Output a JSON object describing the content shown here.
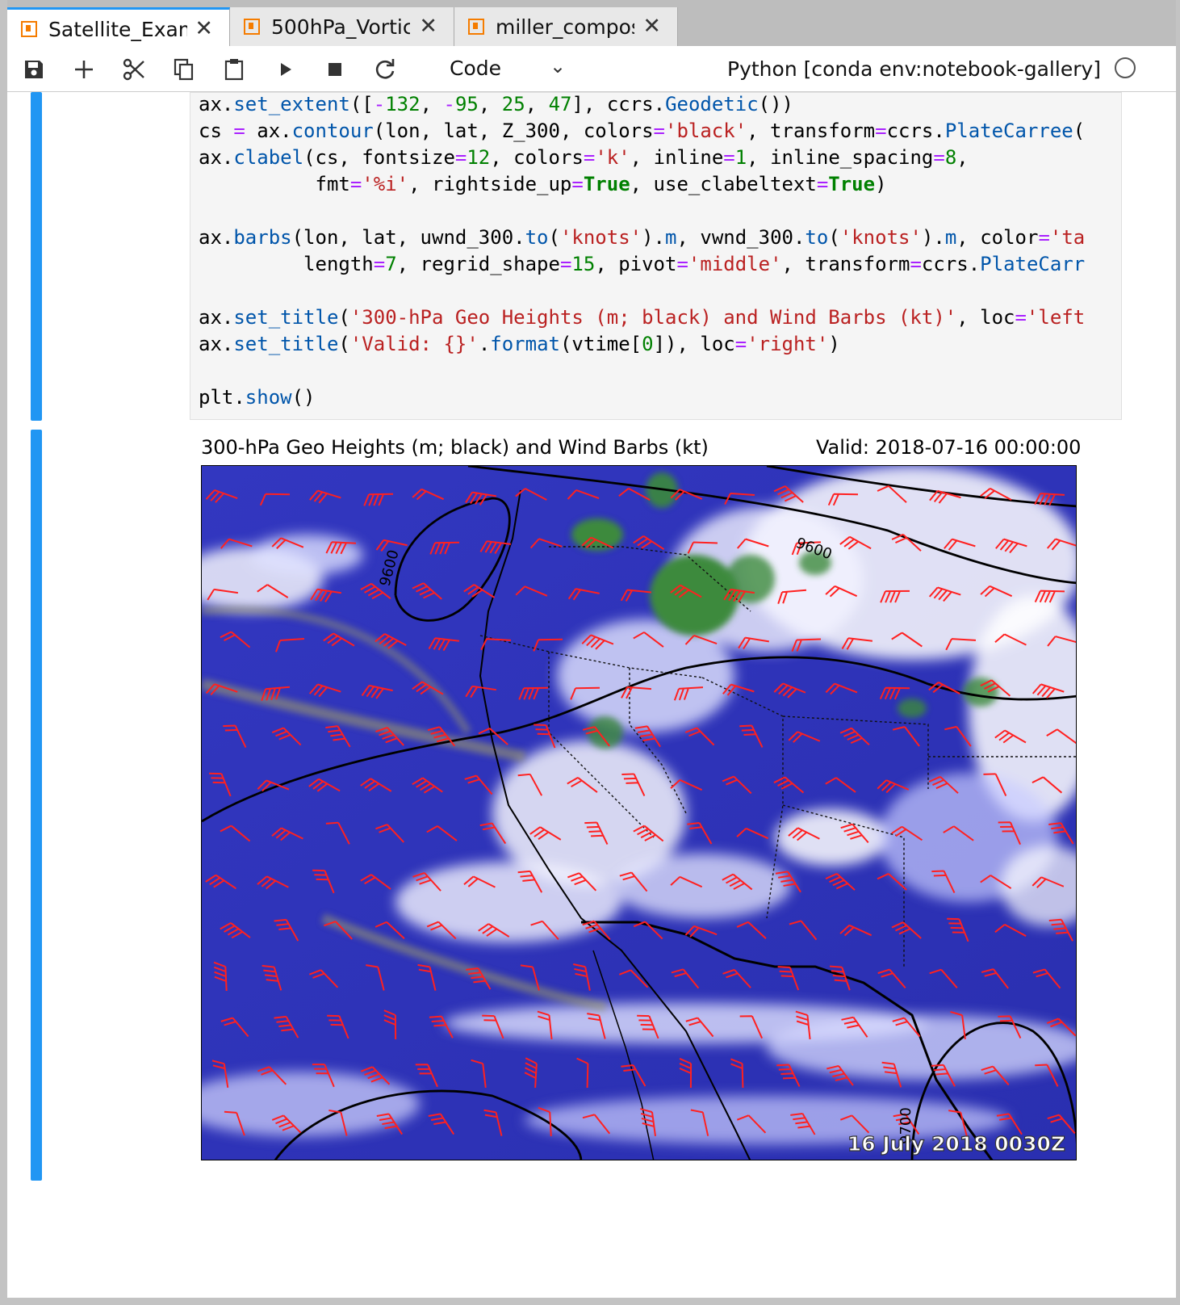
{
  "tabs": [
    {
      "label": "Satellite_Examp",
      "active": true
    },
    {
      "label": "500hPa_Vortic",
      "active": false
    },
    {
      "label": "miller_composi",
      "active": false
    }
  ],
  "toolbar": {
    "cell_type": "Code",
    "kernel": "Python [conda env:notebook-gallery]"
  },
  "code": [
    "ax.set_extent([-132, -95, 25, 47], ccrs.Geodetic())",
    "cs = ax.contour(lon, lat, Z_300, colors='black', transform=ccrs.PlateCarree(",
    "ax.clabel(cs, fontsize=12, colors='k', inline=1, inline_spacing=8,",
    "          fmt='%i', rightside_up=True, use_clabeltext=True)",
    "",
    "ax.barbs(lon, lat, uwnd_300.to('knots').m, vwnd_300.to('knots').m, color='ta",
    "         length=7, regrid_shape=15, pivot='middle', transform=ccrs.PlateCarr",
    "",
    "ax.set_title('300-hPa Geo Heights (m; black) and Wind Barbs (kt)', loc='left",
    "ax.set_title('Valid: {}'.format(vtime[0]), loc='right')",
    "",
    "plt.show()"
  ],
  "figure": {
    "title_left": "300-hPa Geo Heights (m; black) and Wind Barbs (kt)",
    "title_right": "Valid: 2018-07-16 00:00:00",
    "timestamp": "16 July 2018 0030Z",
    "contour_labels": [
      "9600",
      "9600",
      "9700"
    ],
    "colors": {
      "background": "#2a2fb8",
      "clouds": "#ffffff",
      "convection": "#3c8a3c",
      "barbs": "#ff2020",
      "contours": "#000000"
    }
  }
}
